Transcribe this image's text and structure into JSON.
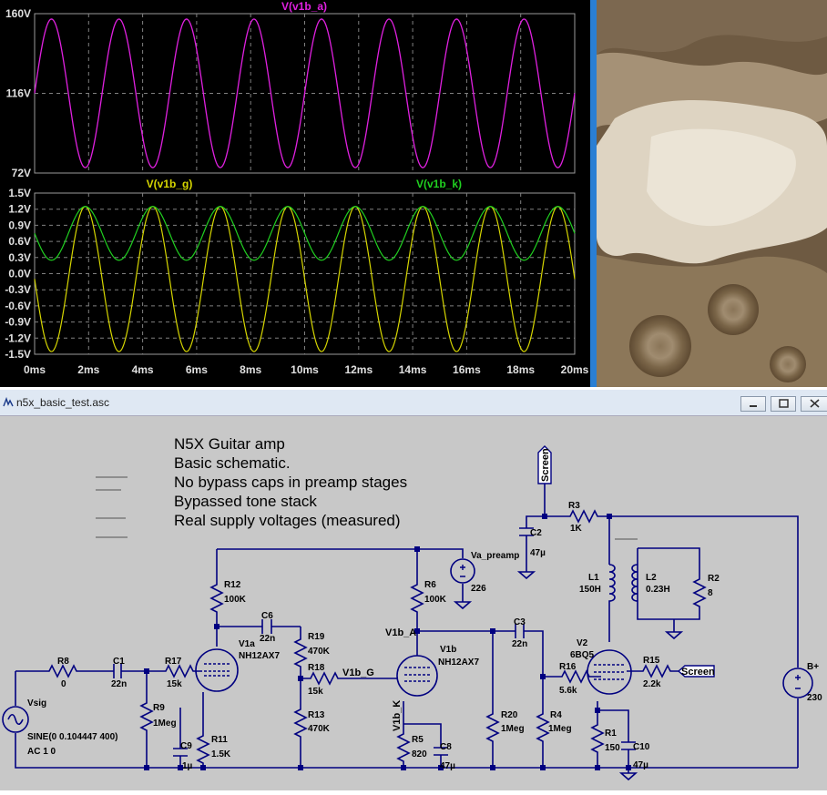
{
  "plot": {
    "top": {
      "trace_label": "V(v1b_a)",
      "color": "#e020e0",
      "ylim": [
        72,
        160
      ],
      "y_ticks": [
        "160V",
        "116V",
        "72V"
      ]
    },
    "bottom": {
      "trace_labels": [
        "V(v1b_g)",
        "V(v1b_k)"
      ],
      "colors": [
        "#d6d600",
        "#20d020"
      ],
      "ylim": [
        -1.5,
        1.5
      ],
      "y_ticks": [
        "1.5V",
        "1.2V",
        "0.9V",
        "0.6V",
        "0.3V",
        "0.0V",
        "-0.3V",
        "-0.6V",
        "-0.9V",
        "-1.2V",
        "-1.5V"
      ]
    },
    "x_ticks": [
      "0ms",
      "2ms",
      "4ms",
      "6ms",
      "8ms",
      "10ms",
      "12ms",
      "14ms",
      "16ms",
      "18ms",
      "20ms"
    ]
  },
  "chart_data": [
    {
      "type": "line",
      "x_range_ms": [
        0,
        20
      ],
      "ylim": [
        72,
        160
      ],
      "series": [
        {
          "name": "V(v1b_a)",
          "frequency_hz": 400,
          "min": 75,
          "max": 157,
          "mid": 116,
          "phase": "rising at 0ms"
        }
      ]
    },
    {
      "type": "line",
      "x_range_ms": [
        0,
        20
      ],
      "ylim": [
        -1.5,
        1.5
      ],
      "series": [
        {
          "name": "V(v1b_g)",
          "frequency_hz": 400,
          "min": -1.45,
          "max": 1.25
        },
        {
          "name": "V(v1b_k)",
          "frequency_hz": 400,
          "min": 0.25,
          "max": 1.25
        }
      ]
    }
  ],
  "window": {
    "title": "n5x_basic_test.asc"
  },
  "notes": [
    "N5X Guitar amp",
    "Basic schematic.",
    "No bypass caps in preamp stages",
    "Bypassed tone stack",
    "Real supply voltages (measured)"
  ],
  "components": {
    "r8": {
      "name": "R8",
      "value": "0"
    },
    "c1": {
      "name": "C1",
      "value": "22n"
    },
    "r17": {
      "name": "R17",
      "value": "15k"
    },
    "r9": {
      "name": "R9",
      "value": "1Meg"
    },
    "c9": {
      "name": "C9",
      "value": "1µ"
    },
    "r11": {
      "name": "R11",
      "value": "1.5K"
    },
    "r12": {
      "name": "R12",
      "value": "100K"
    },
    "v1a": {
      "name": "V1a",
      "value": "NH12AX7"
    },
    "c6": {
      "name": "C6",
      "value": "22n"
    },
    "r19": {
      "name": "R19",
      "value": "470K"
    },
    "r18": {
      "name": "R18",
      "value": "15k"
    },
    "r13": {
      "name": "R13",
      "value": "470K"
    },
    "r6": {
      "name": "R6",
      "value": "100K"
    },
    "v1b": {
      "name": "V1b",
      "value": "NH12AX7"
    },
    "r5": {
      "name": "R5",
      "value": "820"
    },
    "c8": {
      "name": "C8",
      "value": "47µ"
    },
    "c3": {
      "name": "C3",
      "value": "22n"
    },
    "r20": {
      "name": "R20",
      "value": "1Meg"
    },
    "r4": {
      "name": "R4",
      "value": "1Meg"
    },
    "r16": {
      "name": "R16",
      "value": "5.6k"
    },
    "v2": {
      "name": "V2",
      "value": "6BQ5"
    },
    "r15": {
      "name": "R15",
      "value": "2.2k"
    },
    "r1": {
      "name": "R1",
      "value": "150"
    },
    "c10": {
      "name": "C10",
      "value": "47µ"
    },
    "r3": {
      "name": "R3",
      "value": "1K"
    },
    "c2": {
      "name": "C2",
      "value": "47µ"
    },
    "l1": {
      "name": "L1",
      "value": "150H"
    },
    "l2": {
      "name": "L2",
      "value": "0.23H"
    },
    "r2": {
      "name": "R2",
      "value": "8"
    },
    "va_preamp": {
      "name": "Va_preamp",
      "value": "226"
    },
    "bplus": {
      "name": "B+",
      "value": "230"
    },
    "vsig": {
      "name": "Vsig",
      "value": "SINE(0 0.104447 400)",
      "ac": "AC 1 0"
    }
  },
  "net_labels": {
    "screen_top": "Screen",
    "screen_right": "Screen",
    "v1b_g": "V1b_G",
    "v1b_a": "V1b_A",
    "v1b_k": "V1b_K"
  }
}
